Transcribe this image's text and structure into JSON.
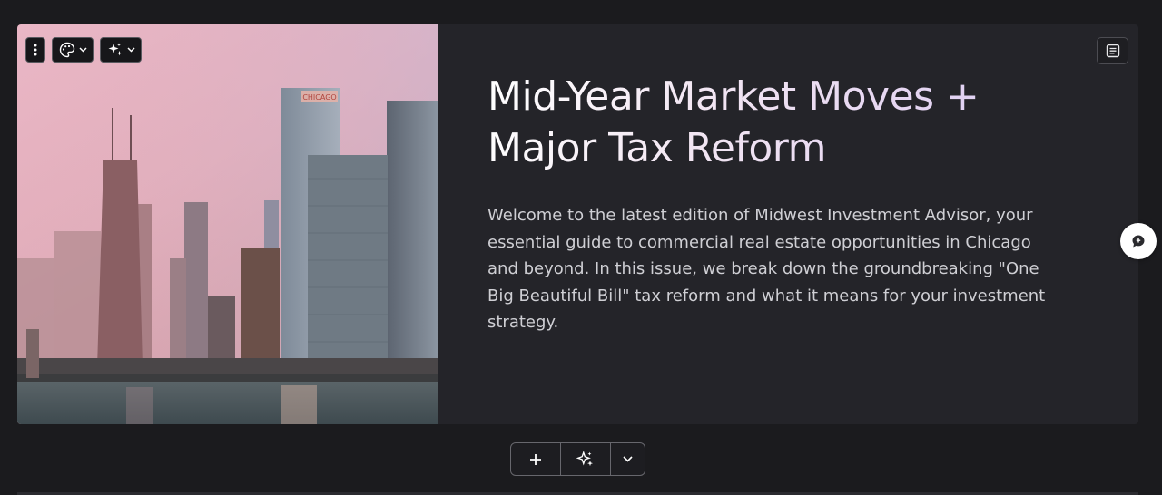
{
  "hero": {
    "headline_line1": "Mid-Year Market Moves +",
    "headline_line2": "Major Tax Reform",
    "intro": "Welcome to the latest edition of Midwest Investment Advisor, your essential guide to commercial real estate opportunities in Chicago and beyond. In this issue, we break down the groundbreaking \"One Big Beautiful Bill\" tax reform and what it means for your investment strategy.",
    "image_sign_text": "CHICAGO"
  },
  "toolbar": {
    "icons": [
      "more-vertical-icon",
      "palette-icon",
      "chevron-down-icon",
      "sparkles-icon",
      "chevron-down-icon"
    ]
  },
  "bottom_bar": {
    "icons": [
      "plus-icon",
      "sparkles-icon",
      "chevron-down-icon"
    ]
  },
  "colors": {
    "page_bg": "#1b1b1e",
    "card_bg": "#242429",
    "headline_gradient_end": "#d9cbf5",
    "intro_text": "#cfcfd4"
  }
}
